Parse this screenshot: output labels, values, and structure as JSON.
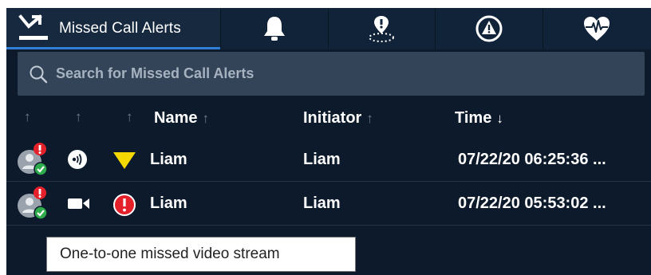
{
  "tabs": [
    {
      "label": "Missed Call Alerts",
      "icon": "missed-call-icon",
      "active": true
    },
    {
      "icon": "bell-icon",
      "active": false
    },
    {
      "icon": "geofence-icon",
      "active": false
    },
    {
      "icon": "warning-icon",
      "active": false
    },
    {
      "icon": "health-monitor-icon",
      "active": false
    }
  ],
  "search": {
    "placeholder": "Search for Missed Call Alerts",
    "value": ""
  },
  "header": {
    "sort_arrow": "↑",
    "name": "Name",
    "initiator": "Initiator",
    "time": "Time",
    "time_sort": "↓"
  },
  "rows": [
    {
      "media": "audio-icon",
      "priority": "warning-triangle-icon",
      "name": "Liam",
      "initiator": "Liam",
      "time": "07/22/20 06:25:36 ..."
    },
    {
      "media": "video-icon",
      "priority": "urgent-icon",
      "name": "Liam",
      "initiator": "Liam",
      "time": "07/22/20 05:53:02 ..."
    }
  ],
  "tooltip": {
    "text": "One-to-one missed video stream"
  },
  "colors": {
    "background": "#0c1a2b",
    "tab_active_underline": "#2f7fd6",
    "search_bg": "#344458",
    "alert_red": "#e4202b",
    "status_green": "#2eab4a",
    "warning_yellow": "#f5d800"
  }
}
